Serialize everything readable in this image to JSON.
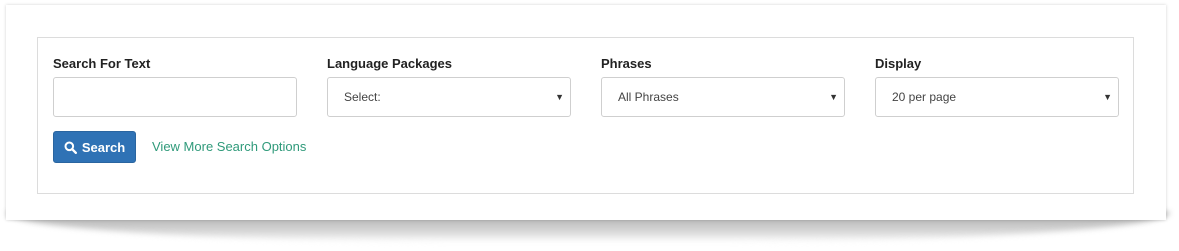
{
  "form": {
    "search_text": {
      "label": "Search For Text",
      "value": "",
      "placeholder": ""
    },
    "language_packages": {
      "label": "Language Packages",
      "selected": "Select:"
    },
    "phrases": {
      "label": "Phrases",
      "selected": "All Phrases"
    },
    "display": {
      "label": "Display",
      "selected": "20 per page"
    }
  },
  "actions": {
    "search_label": "Search",
    "more_options_label": "View More Search Options"
  },
  "colors": {
    "primary_button": "#2f72b5",
    "link": "#2f9a7a"
  },
  "icons": {
    "search_button_icon": "search-icon",
    "select_caret_icon": "caret-down-icon"
  }
}
